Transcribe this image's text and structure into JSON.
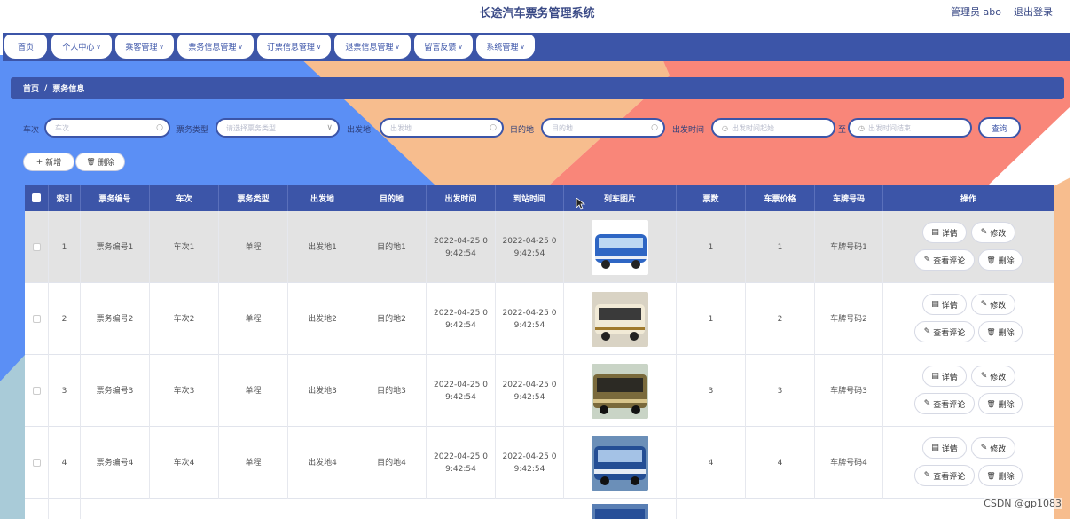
{
  "header": {
    "title": "长途汽车票务管理系统",
    "user_label": "管理员 abo",
    "logout": "退出登录"
  },
  "nav": [
    {
      "label": "首页",
      "chev": ""
    },
    {
      "label": "个人中心",
      "chev": "∨"
    },
    {
      "label": "乘客管理",
      "chev": "∨"
    },
    {
      "label": "票务信息管理",
      "chev": "∨"
    },
    {
      "label": "订票信息管理",
      "chev": "∨"
    },
    {
      "label": "退票信息管理",
      "chev": "∨"
    },
    {
      "label": "留言反馈",
      "chev": "∨"
    },
    {
      "label": "系统管理",
      "chev": "∨"
    }
  ],
  "breadcrumb": {
    "home": "首页",
    "sep": "/",
    "current": "票务信息"
  },
  "filters": {
    "train_label": "车次",
    "train_placeholder": "车次",
    "type_label": "票务类型",
    "type_placeholder": "请选择票务类型",
    "from_label": "出发地",
    "from_placeholder": "出发地",
    "to_label": "目的地",
    "to_placeholder": "目的地",
    "time_label": "出发时间",
    "time_start_placeholder": "出发时间起始",
    "time_sep": "至",
    "time_end_placeholder": "出发时间结束",
    "query": "查询"
  },
  "actions": {
    "add": "新增",
    "add_icon": "+",
    "delete": "删除",
    "delete_icon": "🗑"
  },
  "table": {
    "columns": [
      "索引",
      "票务编号",
      "车次",
      "票务类型",
      "出发地",
      "目的地",
      "出发时间",
      "到站时间",
      "列车图片",
      "票数",
      "车票价格",
      "车牌号码",
      "操作"
    ],
    "rows": [
      {
        "index": "1",
        "ticket_no": "票务编号1",
        "train": "车次1",
        "type": "单程",
        "from": "出发地1",
        "to": "目的地1",
        "depart_l1": "2022-04-25 0",
        "depart_l2": "9:42:54",
        "arrive_l1": "2022-04-25 0",
        "arrive_l2": "9:42:54",
        "count": "1",
        "price": "1",
        "plate": "车牌号码1"
      },
      {
        "index": "2",
        "ticket_no": "票务编号2",
        "train": "车次2",
        "type": "单程",
        "from": "出发地2",
        "to": "目的地2",
        "depart_l1": "2022-04-25 0",
        "depart_l2": "9:42:54",
        "arrive_l1": "2022-04-25 0",
        "arrive_l2": "9:42:54",
        "count": "1",
        "price": "2",
        "plate": "车牌号码2"
      },
      {
        "index": "3",
        "ticket_no": "票务编号3",
        "train": "车次3",
        "type": "单程",
        "from": "出发地3",
        "to": "目的地3",
        "depart_l1": "2022-04-25 0",
        "depart_l2": "9:42:54",
        "arrive_l1": "2022-04-25 0",
        "arrive_l2": "9:42:54",
        "count": "3",
        "price": "3",
        "plate": "车牌号码3"
      },
      {
        "index": "4",
        "ticket_no": "票务编号4",
        "train": "车次4",
        "type": "单程",
        "from": "出发地4",
        "to": "目的地4",
        "depart_l1": "2022-04-25 0",
        "depart_l2": "9:42:54",
        "arrive_l1": "2022-04-25 0",
        "arrive_l2": "9:42:54",
        "count": "4",
        "price": "4",
        "plate": "车牌号码4"
      }
    ],
    "op_labels": {
      "detail": "详情",
      "edit": "修改",
      "comments": "查看评论",
      "delete": "删除"
    }
  },
  "watermark": "CSDN @gp1083",
  "colors": {
    "primary": "#3c55a8",
    "bg_blue": "#5b8ff5",
    "bg_peach": "#f7bd8e",
    "bg_salmon": "#f98679",
    "bg_lightblue": "#a9cbd8"
  },
  "icons": {
    "search": "○",
    "chevron": "∨",
    "clock": "◷",
    "detail": "▤",
    "edit": "✎",
    "delete": "🗑"
  }
}
